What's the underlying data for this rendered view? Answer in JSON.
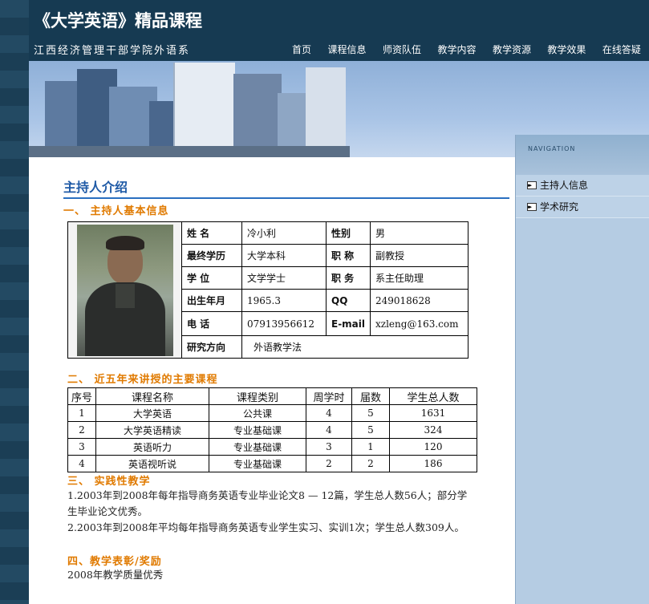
{
  "header": {
    "title": "《大学英语》精品课程",
    "subtitle": "江西经济管理干部学院外语系"
  },
  "nav": [
    "首页",
    "课程信息",
    "师资队伍",
    "教学内容",
    "教学资源",
    "教学效果",
    "在线答疑"
  ],
  "sidebar": {
    "heading": "NAVIGATION",
    "items": [
      "主持人信息",
      "学术研究"
    ]
  },
  "content": {
    "page_title": "主持人介绍",
    "section1": "一、  主持人基本信息",
    "info": {
      "name_label": "姓 名",
      "name": "冷小利",
      "gender_label": "性别",
      "gender": "男",
      "edu_label": "最终学历",
      "edu": "大学本科",
      "rank_label": "职 称",
      "rank": "副教授",
      "degree_label": "学 位",
      "degree": "文学学士",
      "position_label": "职 务",
      "position": "系主任助理",
      "birth_label": "出生年月",
      "birth": "1965.3",
      "qq_label": "QQ",
      "qq": "249018628",
      "phone_label": "电 话",
      "phone": "07913956612",
      "email_label": "E-mail",
      "email": "xzleng@163.com",
      "research_label": "研究方向",
      "research": "外语教学法"
    },
    "section2": "二、  近五年来讲授的主要课程",
    "courses": {
      "headers": [
        "序号",
        "课程名称",
        "课程类别",
        "周学时",
        "届数",
        "学生总人数"
      ],
      "rows": [
        [
          "1",
          "大学英语",
          "公共课",
          "4",
          "5",
          "1631"
        ],
        [
          "2",
          "大学英语精读",
          "专业基础课",
          "4",
          "5",
          "324"
        ],
        [
          "3",
          "英语听力",
          "专业基础课",
          "3",
          "1",
          "120"
        ],
        [
          "4",
          "英语视听说",
          "专业基础课",
          "2",
          "2",
          "186"
        ]
      ]
    },
    "section3": "三、  实践性教学",
    "practice": [
      "1.2003年到2008年每年指导商务英语专业毕业论文8 — 12篇，学生总人数56人；部分学生毕业论文优秀。",
      "2.2003年到2008年平均每年指导商务英语专业学生实习、实训1次；学生总人数309人。"
    ],
    "section4": "四、教学表彰/奖励",
    "award": "2008年教学质量优秀"
  },
  "colors": {
    "header_bg": "#163a52",
    "section_orange": "#e07a00",
    "title_blue": "#1f5aa6",
    "sidebar_bg": "#b5cce3"
  }
}
